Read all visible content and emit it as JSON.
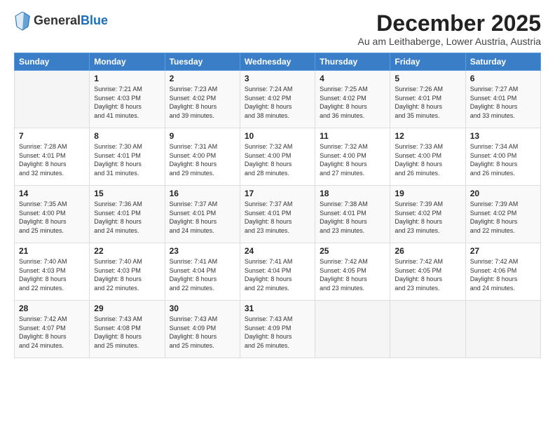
{
  "header": {
    "logo": {
      "general": "General",
      "blue": "Blue"
    },
    "title": "December 2025",
    "location": "Au am Leithaberge, Lower Austria, Austria"
  },
  "calendar": {
    "days_of_week": [
      "Sunday",
      "Monday",
      "Tuesday",
      "Wednesday",
      "Thursday",
      "Friday",
      "Saturday"
    ],
    "weeks": [
      [
        {
          "day": "",
          "info": ""
        },
        {
          "day": "1",
          "info": "Sunrise: 7:21 AM\nSunset: 4:03 PM\nDaylight: 8 hours\nand 41 minutes."
        },
        {
          "day": "2",
          "info": "Sunrise: 7:23 AM\nSunset: 4:02 PM\nDaylight: 8 hours\nand 39 minutes."
        },
        {
          "day": "3",
          "info": "Sunrise: 7:24 AM\nSunset: 4:02 PM\nDaylight: 8 hours\nand 38 minutes."
        },
        {
          "day": "4",
          "info": "Sunrise: 7:25 AM\nSunset: 4:02 PM\nDaylight: 8 hours\nand 36 minutes."
        },
        {
          "day": "5",
          "info": "Sunrise: 7:26 AM\nSunset: 4:01 PM\nDaylight: 8 hours\nand 35 minutes."
        },
        {
          "day": "6",
          "info": "Sunrise: 7:27 AM\nSunset: 4:01 PM\nDaylight: 8 hours\nand 33 minutes."
        }
      ],
      [
        {
          "day": "7",
          "info": "Sunrise: 7:28 AM\nSunset: 4:01 PM\nDaylight: 8 hours\nand 32 minutes."
        },
        {
          "day": "8",
          "info": "Sunrise: 7:30 AM\nSunset: 4:01 PM\nDaylight: 8 hours\nand 31 minutes."
        },
        {
          "day": "9",
          "info": "Sunrise: 7:31 AM\nSunset: 4:00 PM\nDaylight: 8 hours\nand 29 minutes."
        },
        {
          "day": "10",
          "info": "Sunrise: 7:32 AM\nSunset: 4:00 PM\nDaylight: 8 hours\nand 28 minutes."
        },
        {
          "day": "11",
          "info": "Sunrise: 7:32 AM\nSunset: 4:00 PM\nDaylight: 8 hours\nand 27 minutes."
        },
        {
          "day": "12",
          "info": "Sunrise: 7:33 AM\nSunset: 4:00 PM\nDaylight: 8 hours\nand 26 minutes."
        },
        {
          "day": "13",
          "info": "Sunrise: 7:34 AM\nSunset: 4:00 PM\nDaylight: 8 hours\nand 26 minutes."
        }
      ],
      [
        {
          "day": "14",
          "info": "Sunrise: 7:35 AM\nSunset: 4:00 PM\nDaylight: 8 hours\nand 25 minutes."
        },
        {
          "day": "15",
          "info": "Sunrise: 7:36 AM\nSunset: 4:01 PM\nDaylight: 8 hours\nand 24 minutes."
        },
        {
          "day": "16",
          "info": "Sunrise: 7:37 AM\nSunset: 4:01 PM\nDaylight: 8 hours\nand 24 minutes."
        },
        {
          "day": "17",
          "info": "Sunrise: 7:37 AM\nSunset: 4:01 PM\nDaylight: 8 hours\nand 23 minutes."
        },
        {
          "day": "18",
          "info": "Sunrise: 7:38 AM\nSunset: 4:01 PM\nDaylight: 8 hours\nand 23 minutes."
        },
        {
          "day": "19",
          "info": "Sunrise: 7:39 AM\nSunset: 4:02 PM\nDaylight: 8 hours\nand 23 minutes."
        },
        {
          "day": "20",
          "info": "Sunrise: 7:39 AM\nSunset: 4:02 PM\nDaylight: 8 hours\nand 22 minutes."
        }
      ],
      [
        {
          "day": "21",
          "info": "Sunrise: 7:40 AM\nSunset: 4:03 PM\nDaylight: 8 hours\nand 22 minutes."
        },
        {
          "day": "22",
          "info": "Sunrise: 7:40 AM\nSunset: 4:03 PM\nDaylight: 8 hours\nand 22 minutes."
        },
        {
          "day": "23",
          "info": "Sunrise: 7:41 AM\nSunset: 4:04 PM\nDaylight: 8 hours\nand 22 minutes."
        },
        {
          "day": "24",
          "info": "Sunrise: 7:41 AM\nSunset: 4:04 PM\nDaylight: 8 hours\nand 22 minutes."
        },
        {
          "day": "25",
          "info": "Sunrise: 7:42 AM\nSunset: 4:05 PM\nDaylight: 8 hours\nand 23 minutes."
        },
        {
          "day": "26",
          "info": "Sunrise: 7:42 AM\nSunset: 4:05 PM\nDaylight: 8 hours\nand 23 minutes."
        },
        {
          "day": "27",
          "info": "Sunrise: 7:42 AM\nSunset: 4:06 PM\nDaylight: 8 hours\nand 24 minutes."
        }
      ],
      [
        {
          "day": "28",
          "info": "Sunrise: 7:42 AM\nSunset: 4:07 PM\nDaylight: 8 hours\nand 24 minutes."
        },
        {
          "day": "29",
          "info": "Sunrise: 7:43 AM\nSunset: 4:08 PM\nDaylight: 8 hours\nand 25 minutes."
        },
        {
          "day": "30",
          "info": "Sunrise: 7:43 AM\nSunset: 4:09 PM\nDaylight: 8 hours\nand 25 minutes."
        },
        {
          "day": "31",
          "info": "Sunrise: 7:43 AM\nSunset: 4:09 PM\nDaylight: 8 hours\nand 26 minutes."
        },
        {
          "day": "",
          "info": ""
        },
        {
          "day": "",
          "info": ""
        },
        {
          "day": "",
          "info": ""
        }
      ]
    ]
  }
}
